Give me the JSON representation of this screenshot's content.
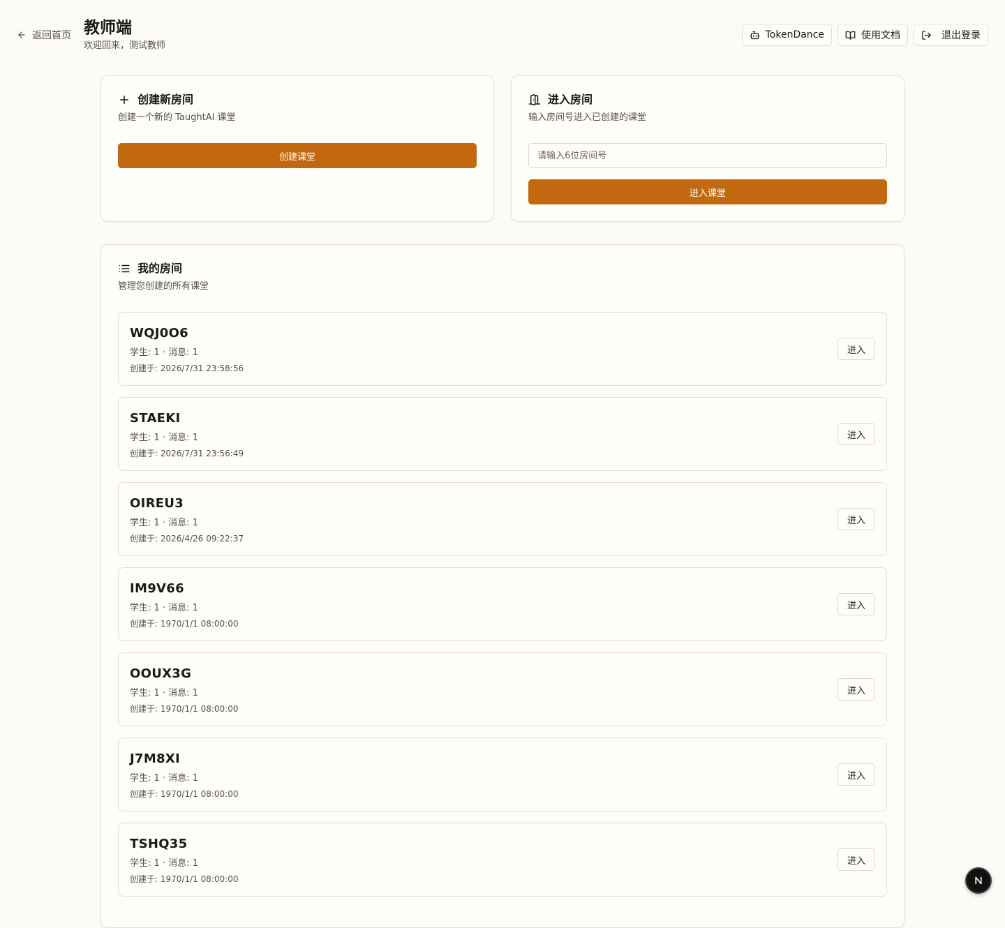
{
  "header": {
    "back_label": "返回首页",
    "title": "教师端",
    "subtitle": "欢迎回来，测试教师",
    "actions": [
      {
        "label": "TokenDance",
        "icon": "robot-icon"
      },
      {
        "label": "使用文档",
        "icon": "book-icon"
      },
      {
        "label": "退出登录",
        "icon": "logout-icon"
      }
    ]
  },
  "create_card": {
    "title": "创建新房间",
    "description": "创建一个新的 TaughtAI 课堂",
    "button_label": "创建课堂"
  },
  "join_card": {
    "title": "进入房间",
    "description": "输入房间号进入已创建的课堂",
    "input_placeholder": "请输入6位房间号",
    "input_value": "",
    "button_label": "进入课堂"
  },
  "rooms_card": {
    "title": "我的房间",
    "description": "管理您创建的所有课堂",
    "enter_label": "进入",
    "rooms": [
      {
        "code": "WQJ0O6",
        "stats": "学生: 1 · 消息: 1",
        "created": "创建于: 2026/7/31 23:58:56"
      },
      {
        "code": "STAEKI",
        "stats": "学生: 1 · 消息: 1",
        "created": "创建于: 2026/7/31 23:56:49"
      },
      {
        "code": "OIREU3",
        "stats": "学生: 1 · 消息: 1",
        "created": "创建于: 2026/4/26 09:22:37"
      },
      {
        "code": "IM9V66",
        "stats": "学生: 1 · 消息: 1",
        "created": "创建于: 1970/1/1 08:00:00"
      },
      {
        "code": "OOUX3G",
        "stats": "学生: 1 · 消息: 1",
        "created": "创建于: 1970/1/1 08:00:00"
      },
      {
        "code": "J7M8XI",
        "stats": "学生: 1 · 消息: 1",
        "created": "创建于: 1970/1/1 08:00:00"
      },
      {
        "code": "TSHQ35",
        "stats": "学生: 1 · 消息: 1",
        "created": "创建于: 1970/1/1 08:00:00"
      }
    ]
  },
  "colors": {
    "background": "#fdfbf6",
    "accent": "#c2690f",
    "border": "#e6e0d6",
    "text": "#1c1a17",
    "muted_text": "#55504a"
  }
}
